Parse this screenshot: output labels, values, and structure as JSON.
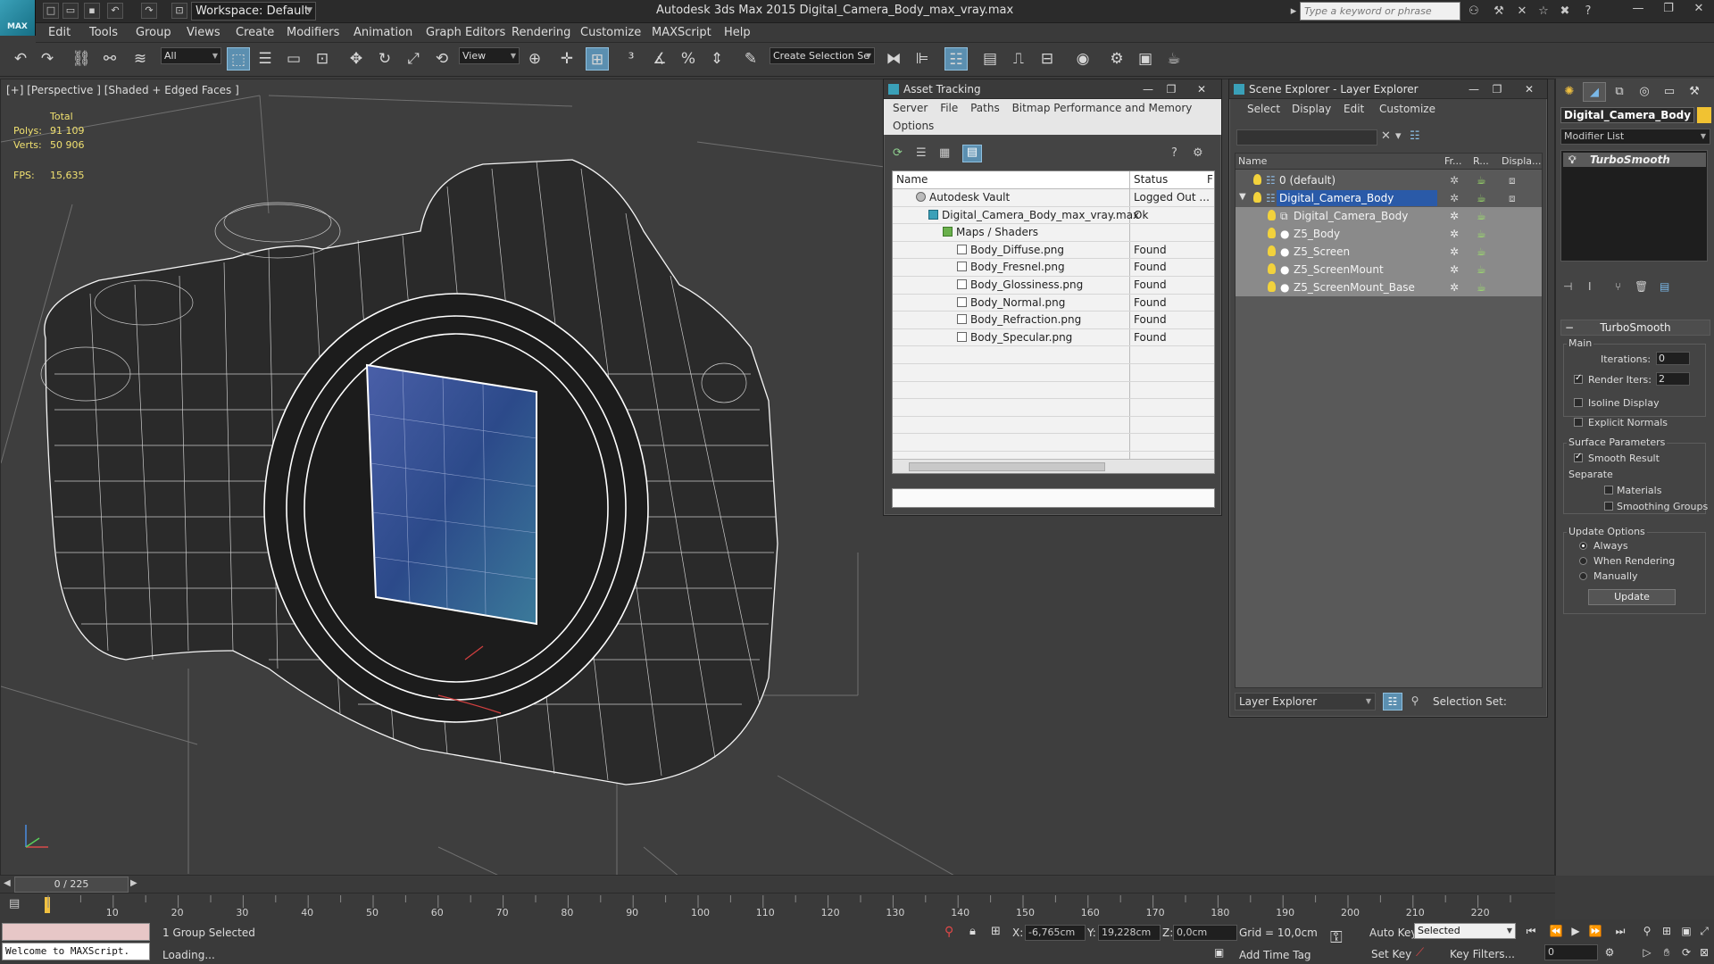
{
  "app": {
    "logo_text": "MAX",
    "workspace_label": "Workspace: Default",
    "title": "Autodesk 3ds Max 2015     Digital_Camera_Body_max_vray.max",
    "search_placeholder": "Type a keyword or phrase"
  },
  "menu": [
    "Edit",
    "Tools",
    "Group",
    "Views",
    "Create",
    "Modifiers",
    "Animation",
    "Graph Editors",
    "Rendering",
    "Customize",
    "MAXScript",
    "Help"
  ],
  "toolbar": {
    "selection_filter": "All",
    "ref_coord": "View",
    "named_selection": "Create Selection Se"
  },
  "viewport": {
    "label": "[+] [Perspective ] [Shaded + Edged Faces ]",
    "stats_total_label": "Total",
    "polys_label": "Polys:",
    "polys_value": "91 109",
    "verts_label": "Verts:",
    "verts_value": "50 906",
    "fps_label": "FPS:",
    "fps_value": "15,635"
  },
  "asset_tracking": {
    "title": "Asset Tracking",
    "menu": [
      "Server",
      "File",
      "Paths",
      "Bitmap Performance and Memory"
    ],
    "menu2": [
      "Options"
    ],
    "col_name": "Name",
    "col_status": "Status",
    "col_extra": "F",
    "rows": [
      {
        "name": "Autodesk Vault",
        "status": "Logged Out ..."
      },
      {
        "name": "Digital_Camera_Body_max_vray.max",
        "status": "Ok"
      },
      {
        "name": "Maps / Shaders",
        "status": ""
      },
      {
        "name": "Body_Diffuse.png",
        "status": "Found"
      },
      {
        "name": "Body_Fresnel.png",
        "status": "Found"
      },
      {
        "name": "Body_Glossiness.png",
        "status": "Found"
      },
      {
        "name": "Body_Normal.png",
        "status": "Found"
      },
      {
        "name": "Body_Refraction.png",
        "status": "Found"
      },
      {
        "name": "Body_Specular.png",
        "status": "Found"
      }
    ]
  },
  "scene_explorer": {
    "title": "Scene Explorer - Layer Explorer",
    "menu": [
      "Select",
      "Display",
      "Edit",
      "Customize"
    ],
    "col_name": "Name",
    "col_fr": "Fr...",
    "col_r": "R...",
    "col_disp": "Displa...",
    "rows": [
      {
        "name": "0 (default)"
      },
      {
        "name": "Digital_Camera_Body"
      },
      {
        "name": "Digital_Camera_Body"
      },
      {
        "name": "Z5_Body"
      },
      {
        "name": "Z5_Screen"
      },
      {
        "name": "Z5_ScreenMount"
      },
      {
        "name": "Z5_ScreenMount_Base"
      }
    ],
    "footer_combo": "Layer Explorer",
    "selection_set_label": "Selection Set:"
  },
  "command_panel": {
    "object_name": "Digital_Camera_Body",
    "object_color": "#f1c232",
    "modifier_list": "Modifier List",
    "stack_item": "TurboSmooth",
    "rollout_title": "TurboSmooth",
    "main_group": "Main",
    "iterations_label": "Iterations:",
    "iterations_value": "0",
    "render_iters_label": "Render Iters:",
    "render_iters_value": "2",
    "isoline_label": "Isoline Display",
    "explicit_normals_label": "Explicit Normals",
    "surface_group": "Surface Parameters",
    "smooth_result_label": "Smooth Result",
    "separate_label": "Separate",
    "materials_label": "Materials",
    "smoothing_groups_label": "Smoothing Groups",
    "update_group": "Update Options",
    "always_label": "Always",
    "when_rendering_label": "When Rendering",
    "manually_label": "Manually",
    "update_button": "Update"
  },
  "timeline": {
    "slider_label": "0 / 225",
    "ticks": [
      "10",
      "20",
      "30",
      "40",
      "50",
      "60",
      "70",
      "80",
      "90",
      "100",
      "110",
      "120",
      "130",
      "140",
      "150",
      "160",
      "170",
      "180",
      "190",
      "200",
      "210",
      "220"
    ]
  },
  "status": {
    "maxscript_output": "Welcome to MAXScript.",
    "selection_info": "1 Group Selected",
    "prompt": "Loading...",
    "x_label": "X:",
    "x_value": "-6,765cm",
    "y_label": "Y:",
    "y_value": "19,228cm",
    "z_label": "Z:",
    "z_value": "0,0cm",
    "grid": "Grid = 10,0cm",
    "add_time_tag": "Add Time Tag",
    "auto_key": "Auto Key",
    "set_key": "Set Key",
    "selected_combo": "Selected",
    "key_filters": "Key Filters...",
    "frame_value": "0"
  }
}
